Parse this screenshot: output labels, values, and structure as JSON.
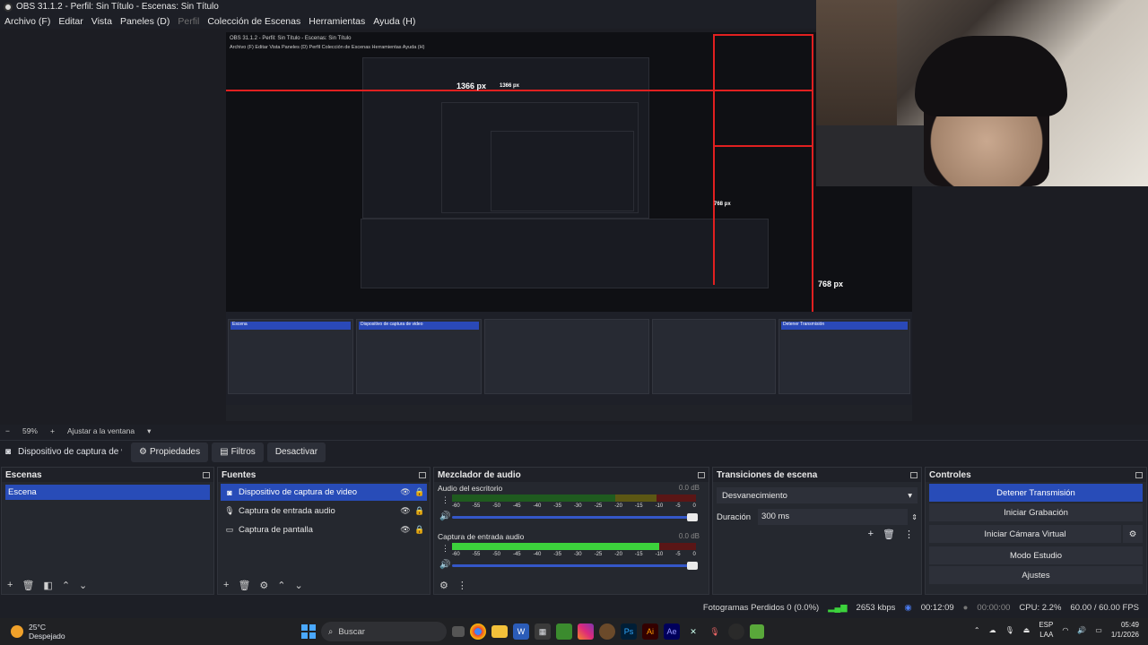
{
  "window": {
    "title": "OBS 31.1.2 - Perfil: Sin Título - Escenas: Sin Título"
  },
  "menu": [
    {
      "label": "Archivo (F)",
      "disabled": false
    },
    {
      "label": "Editar",
      "disabled": false
    },
    {
      "label": "Vista",
      "disabled": false
    },
    {
      "label": "Paneles (D)",
      "disabled": false
    },
    {
      "label": "Perfil",
      "disabled": true
    },
    {
      "label": "Colección de Escenas",
      "disabled": false
    },
    {
      "label": "Herramientas",
      "disabled": false
    },
    {
      "label": "Ayuda (H)",
      "disabled": false
    }
  ],
  "preview": {
    "width_label": "1366 px",
    "width_label_2": "1366 px",
    "height_label": "768 px",
    "height_label_small": "768 px",
    "inner_title": "OBS 31.1.2 - Perfil: Sin Título - Escenas: Sin Título",
    "inner_menu": "Archivo (F)   Editar   Vista   Paneles (D)   Perfil   Colección de Escenas   Herramientas   Ayuda (H)",
    "inner_scene": "Escena",
    "inner_source": "Dispositivo de captura de video",
    "inner_start": "Detener Transmisión"
  },
  "transform": {
    "zoom": "59%",
    "fit_label": "Ajustar a la ventana"
  },
  "source_toolbar": {
    "current_source": "Dispositivo de captura de v",
    "properties": "Propiedades",
    "filters": "Filtros",
    "deactivate": "Desactivar"
  },
  "scenes": {
    "title": "Escenas",
    "items": [
      "Escena"
    ]
  },
  "sources": {
    "title": "Fuentes",
    "items": [
      {
        "label": "Dispositivo de captura de video",
        "icon": "camera-icon",
        "selected": true
      },
      {
        "label": "Captura de entrada audio",
        "icon": "microphone-icon",
        "selected": false
      },
      {
        "label": "Captura de pantalla",
        "icon": "monitor-icon",
        "selected": false
      }
    ]
  },
  "mixer": {
    "title": "Mezclador de audio",
    "channels": [
      {
        "name": "Audio del escritorio",
        "db": "0.0 dB",
        "level": 0.0,
        "volume": 1.0
      },
      {
        "name": "Captura de entrada audio",
        "db": "0.0 dB",
        "level": 0.85,
        "volume": 1.0
      }
    ],
    "ticks": [
      "-60",
      "-55",
      "-50",
      "-45",
      "-40",
      "-35",
      "-30",
      "-25",
      "-20",
      "-15",
      "-10",
      "-5",
      "0"
    ]
  },
  "transitions": {
    "title": "Transiciones de escena",
    "selected": "Desvanecimiento",
    "duration_label": "Duración",
    "duration_value": "300 ms"
  },
  "controls": {
    "title": "Controles",
    "stream": "Detener Transmisión",
    "record": "Iniciar Grabación",
    "virtual_cam": "Iniciar Cámara Virtual",
    "studio": "Modo Estudio",
    "settings": "Ajustes"
  },
  "status": {
    "dropped": "Fotogramas Perdidos 0 (0.0%)",
    "bitrate": "2653 kbps",
    "stream_time": "00:12:09",
    "rec_time": "00:00:00",
    "cpu": "CPU: 2.2%",
    "fps": "60.00 / 60.00 FPS"
  },
  "taskbar": {
    "temp": "25°C",
    "weather": "Despejado",
    "search": "Buscar",
    "lang": "ESP",
    "lang2": "LAA",
    "time": "05:49",
    "date": "1/1/2026"
  },
  "colors": {
    "accent": "#284cb8",
    "panel": "#25282f",
    "background": "#1d1f26",
    "meter_green": "#3cd23c",
    "guide_red": "#e02020"
  }
}
